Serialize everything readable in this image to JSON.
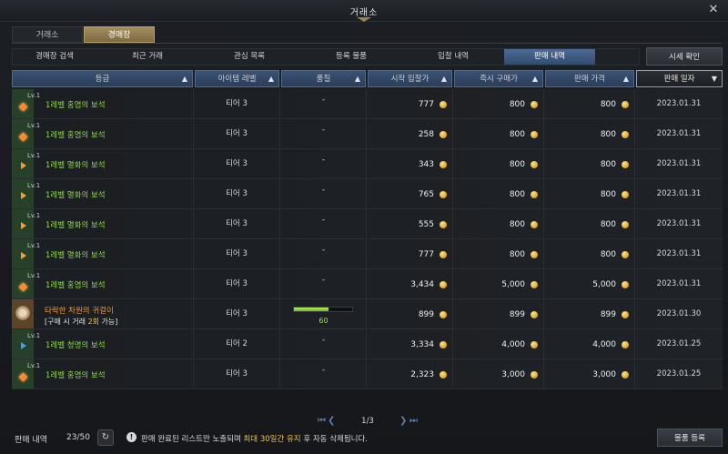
{
  "window": {
    "title": "거래소"
  },
  "main_tabs": [
    {
      "label": "거래소",
      "active": false
    },
    {
      "label": "경매장",
      "active": true
    }
  ],
  "sub_tabs": [
    {
      "label": "경매장 검색",
      "active": false
    },
    {
      "label": "최근 거래",
      "active": false
    },
    {
      "label": "관심 목록",
      "active": false
    },
    {
      "label": "등록 물품",
      "active": false
    },
    {
      "label": "입찰 내역",
      "active": false
    },
    {
      "label": "판매 내역",
      "active": true
    }
  ],
  "price_check_label": "시세 확인",
  "columns": {
    "grade": "등급",
    "item_level": "아이템 레벨",
    "quality": "품질",
    "start_bid": "시작 입찰가",
    "instant_buy": "즉시 구매가",
    "sell_price": "판매 가격",
    "sell_date": "판매 일자"
  },
  "rows": [
    {
      "lv": "Lv.1",
      "name": "1레벨 홍염의 보석",
      "icon": "gem-orange",
      "tier": "티어 3",
      "quality": "-",
      "start": "777",
      "buy": "800",
      "sell": "800",
      "date": "2023.01.31"
    },
    {
      "lv": "Lv.1",
      "name": "1레벨 홍염의 보석",
      "icon": "gem-orange",
      "tier": "티어 3",
      "quality": "-",
      "start": "258",
      "buy": "800",
      "sell": "800",
      "date": "2023.01.31"
    },
    {
      "lv": "Lv.1",
      "name": "1레벨 멸화의 보석",
      "icon": "triangle-orange",
      "tier": "티어 3",
      "quality": "-",
      "start": "343",
      "buy": "800",
      "sell": "800",
      "date": "2023.01.31"
    },
    {
      "lv": "Lv.1",
      "name": "1레벨 멸화의 보석",
      "icon": "triangle-orange",
      "tier": "티어 3",
      "quality": "-",
      "start": "765",
      "buy": "800",
      "sell": "800",
      "date": "2023.01.31"
    },
    {
      "lv": "Lv.1",
      "name": "1레벨 멸화의 보석",
      "icon": "triangle-orange",
      "tier": "티어 3",
      "quality": "-",
      "start": "555",
      "buy": "800",
      "sell": "800",
      "date": "2023.01.31"
    },
    {
      "lv": "Lv.1",
      "name": "1레벨 멸화의 보석",
      "icon": "triangle-orange",
      "tier": "티어 3",
      "quality": "-",
      "start": "777",
      "buy": "800",
      "sell": "800",
      "date": "2023.01.31"
    },
    {
      "lv": "Lv.1",
      "name": "1레벨 홍염의 보석",
      "icon": "gem-orange",
      "tier": "티어 3",
      "quality": "-",
      "start": "3,434",
      "buy": "5,000",
      "sell": "5,000",
      "date": "2023.01.31"
    },
    {
      "lv": "",
      "name": "타락한 차원의 귀걸이",
      "icon": "earring",
      "tier": "티어 3",
      "quality": "60",
      "quality_pct": 0.6,
      "sub_prefix": "[구매 시 거래 ",
      "sub_count": "2회",
      "sub_suffix": " 가능]",
      "start": "899",
      "buy": "899",
      "sell": "899",
      "date": "2023.01.30"
    },
    {
      "lv": "Lv.1",
      "name": "1레벨 청명의 보석",
      "icon": "triangle-blue",
      "tier": "티어 2",
      "quality": "-",
      "start": "3,334",
      "buy": "4,000",
      "sell": "4,000",
      "date": "2023.01.25"
    },
    {
      "lv": "Lv.1",
      "name": "1레벨 홍염의 보석",
      "icon": "gem-orange",
      "tier": "티어 3",
      "quality": "-",
      "start": "2,323",
      "buy": "3,000",
      "sell": "3,000",
      "date": "2023.01.25"
    }
  ],
  "pagination": {
    "text": "1/3"
  },
  "footer": {
    "label": "판매 내역",
    "count": "23/50",
    "notice_prefix": "판매 완료된 리스트만 노출되며 ",
    "notice_highlight": "최대 30일간 유지",
    "notice_suffix": " 후 자동 삭제됩니다.",
    "register_label": "물품 등록"
  }
}
